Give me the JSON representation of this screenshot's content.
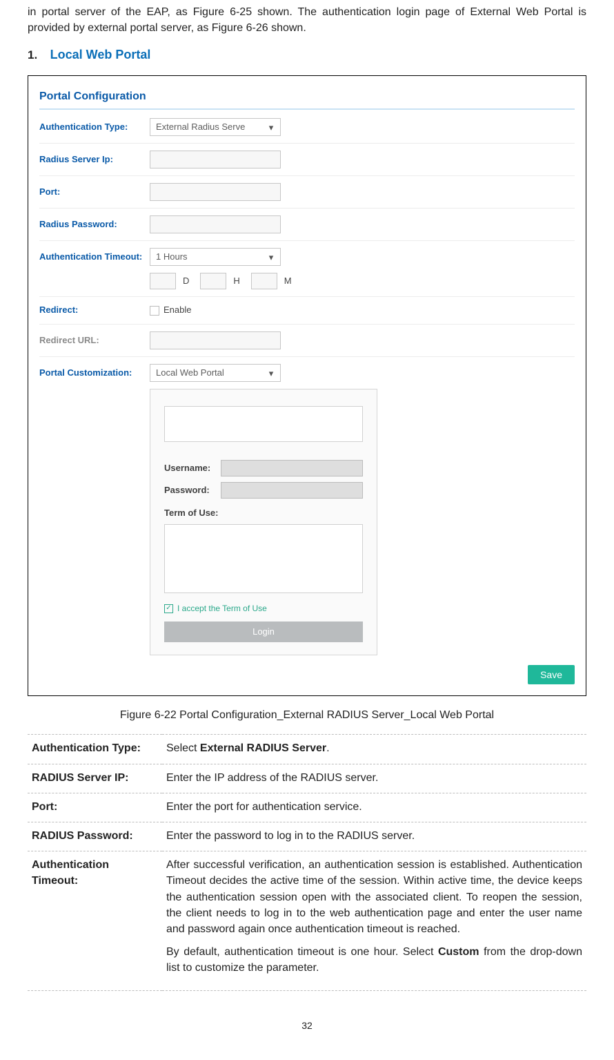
{
  "intro": "in portal server of the EAP, as Figure 6-25 shown. The authentication login page of External Web Portal is provided by external portal server, as Figure 6-26 shown.",
  "section": {
    "num": "1.",
    "title": "Local Web Portal"
  },
  "config": {
    "panel_title": "Portal Configuration",
    "rows": {
      "auth_type_label": "Authentication Type:",
      "auth_type_value": "External Radius Serve",
      "radius_ip_label": "Radius Server Ip:",
      "port_label": "Port:",
      "radius_pwd_label": "Radius Password:",
      "auth_timeout_label": "Authentication Timeout:",
      "auth_timeout_value": "1 Hours",
      "d": "D",
      "h": "H",
      "m": "M",
      "redirect_label": "Redirect:",
      "redirect_enable": "Enable",
      "redirect_url_label": "Redirect URL:",
      "portal_cust_label": "Portal Customization:",
      "portal_cust_value": "Local Web Portal"
    },
    "preview": {
      "username_label": "Username:",
      "password_label": "Password:",
      "terms_label": "Term of Use:",
      "accept_text": "I accept the Term of Use",
      "login_label": "Login"
    },
    "save_label": "Save"
  },
  "figure_caption": "Figure 6-22 Portal Configuration_External RADIUS Server_Local Web Portal",
  "table": [
    {
      "k": "Authentication Type:",
      "v": "Select <b>External RADIUS Server</b>."
    },
    {
      "k": "RADIUS Server IP:",
      "v": "Enter the IP address of the RADIUS server."
    },
    {
      "k": "Port:",
      "v": "Enter the port for authentication service."
    },
    {
      "k": "RADIUS Password:",
      "v": "Enter the password to log in to the RADIUS server."
    },
    {
      "k": "Authentication Timeout:",
      "v": "<p>After successful verification, an authentication session is established. Authentication Timeout decides the active time of the session. Within active time, the device keeps the authentication session open with the associated client. To reopen the session, the client needs to log in to the web authentication page and enter the user name and password again once authentication timeout is reached.</p><p>By default, authentication timeout is one hour. Select <b>Custom</b> from the drop-down list to customize the parameter.</p>"
    }
  ],
  "page_number": "32"
}
